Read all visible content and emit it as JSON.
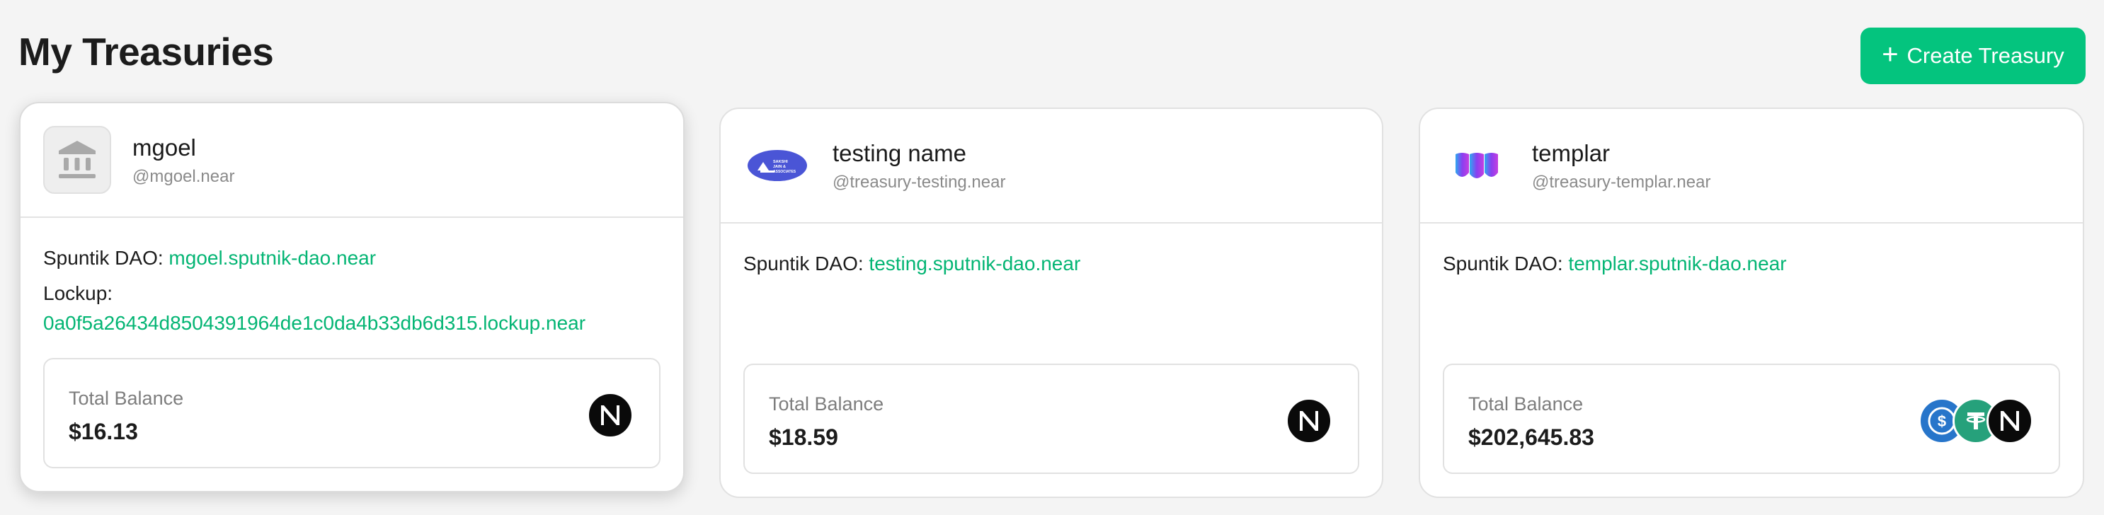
{
  "header": {
    "title": "My Treasuries",
    "create_button": {
      "label": "Create Treasury",
      "icon": "plus-icon"
    }
  },
  "colors": {
    "accent": "#04c47e",
    "link": "#04b574",
    "background": "#f4f4f4"
  },
  "treasuries": [
    {
      "name": "mgoel",
      "account": "@mgoel.near",
      "logo": "bank-icon",
      "dao_label": "Spuntik DAO:",
      "dao": "mgoel.sputnik-dao.near",
      "lockup_label": "Lockup:",
      "lockup": "0a0f5a26434d8504391964de1c0da4b33db6d315.lockup.near",
      "balance_label": "Total Balance",
      "balance": "$16.13",
      "tokens": [
        "near-icon"
      ]
    },
    {
      "name": "testing name",
      "account": "@treasury-testing.near",
      "logo": "sakshi-logo",
      "logo_text": "SAKSHI JAIN & ASSOCIATES",
      "dao_label": "Spuntik DAO:",
      "dao": "testing.sputnik-dao.near",
      "balance_label": "Total Balance",
      "balance": "$18.59",
      "tokens": [
        "near-icon"
      ]
    },
    {
      "name": "templar",
      "account": "@treasury-templar.near",
      "logo": "templar-logo",
      "dao_label": "Spuntik DAO:",
      "dao": "templar.sputnik-dao.near",
      "balance_label": "Total Balance",
      "balance": "$202,645.83",
      "tokens": [
        "usdc-icon",
        "usdt-icon",
        "near-icon"
      ]
    }
  ]
}
